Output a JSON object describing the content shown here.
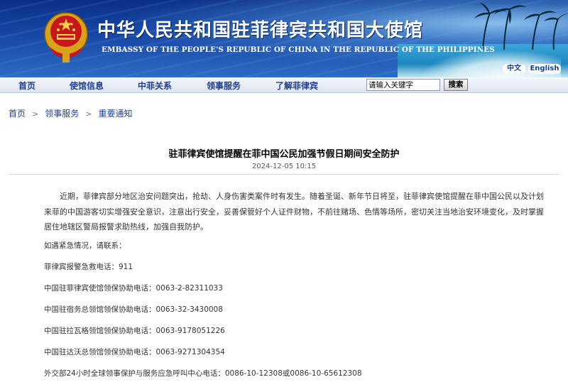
{
  "header": {
    "title_cn": "中华人民共和国驻菲律宾共和国大使馆",
    "title_en": "EMBASSY OF THE PEOPLE'S REPUBLIC OF CHINA IN THE REPUBLIC OF THE PHILIPPINES",
    "lang_cn": "中文",
    "lang_en": "English"
  },
  "nav": {
    "items": [
      "首页",
      "使馆信息",
      "中菲关系",
      "领事服务",
      "了解菲律宾"
    ],
    "search_value": "请输入关键字",
    "search_button": "搜索"
  },
  "breadcrumb": [
    "首页",
    "领事服务",
    "重要通知"
  ],
  "article": {
    "title": "驻菲律宾使馆提醒在菲中国公民加强节假日期间安全防护",
    "date": "2024-12-05 10:15",
    "paragraph": "近期，菲律宾部分地区治安问题突出，抢劫、人身伤害类案件时有发生。随着圣诞、新年节日将至，驻菲律宾使馆提醒在菲中国公民以及计划来菲的中国游客切实增强安全意识，注意出行安全，妥善保管好个人证件财物，不前往赌场、色情等场所，密切关注当地治安环境变化，及时掌握居住地辖区警局报警求助热线，加强自我防护。",
    "lines": [
      "如遇紧急情况，请联系：",
      "菲律宾报警急救电话：911",
      "中国驻菲律宾使馆领保协助电话：0063-2-82311033",
      "中国驻宿务总领馆领保协助电话：0063-32-3430008",
      "中国驻拉瓦格领馆领保协助电话：0063-9178051226",
      "中国驻达沃总领馆领保协助电话：0063-9271304354",
      "外交部24小时全球领事保护与服务应急呼叫中心电话：0086-10-12308或0086-10-65612308"
    ]
  },
  "colors": {
    "banner": "#1747a6",
    "nav_text": "#1e3f8c",
    "title_text": "#000000"
  }
}
